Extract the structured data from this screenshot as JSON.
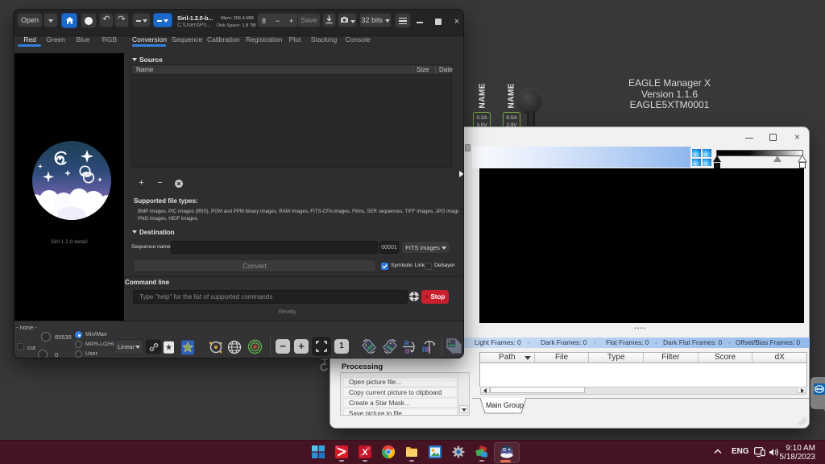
{
  "eagle": {
    "title": "EAGLE Manager X",
    "version": "Version 1.1.6",
    "serial": "EAGLE5XTM0001",
    "port_label_1": "NAME",
    "port_label_2": "NAME",
    "meter_1": {
      "current": "0.2A",
      "voltage": "3.0V"
    },
    "meter_2": {
      "current": "0.0A",
      "voltage": "2.9V"
    }
  },
  "siril": {
    "titlebar": {
      "open_label": "Open",
      "title": "Siril-1.2.0-b...",
      "subtitle": "C:\\Users\\Pri...",
      "mem": "Mem: 206.4 MiB",
      "disk": "Disk Space: 1.8 TiB",
      "zoom_value": "8",
      "minus": "−",
      "plus": "+",
      "save_label": "Save",
      "bit_depth": "32 bits"
    },
    "left_tabs": {
      "t0": "Red",
      "t1": "Green",
      "t2": "Blue",
      "t3": "RGB"
    },
    "logo_caption": "Siril 1.2.0-beta2",
    "right_tabs": {
      "t0": "Conversion",
      "t1": "Sequence",
      "t2": "Calibration",
      "t3": "Registration",
      "t4": "Plot",
      "t5": "Stacking",
      "t6": "Console"
    },
    "source": {
      "header": "Source",
      "col_name": "Name",
      "col_size": "Size",
      "col_date": "Date",
      "add": "+",
      "remove": "−"
    },
    "supported": {
      "label": "Supported file types:",
      "line1": "BMP images, PIC images (IRIS), PGM and PPM binary images, RAW images, FITS-CFA images, Films, SER sequences, TIFF images, JPG images,",
      "line2": "PNG images, HEIF images."
    },
    "destination": {
      "header": "Destination",
      "sequence_label": "Sequence name:",
      "sequence_value": "",
      "counter": "00001",
      "format": "FITS images",
      "convert_label": "Convert",
      "symbolic_link_label": "Symbolic Link",
      "debayer_label": "Debayer"
    },
    "command": {
      "header": "Command line",
      "placeholder": "Type \"help\" for the list of supported commands",
      "stop_label": "Stop",
      "status": "Ready."
    },
    "toolbar": {
      "none_label": "- none -",
      "cut_label": "cut",
      "hi_value": "65535",
      "lo_value": "0",
      "radio_minmax": "Min/Max",
      "radio_mips": "MIPS-LO/HI",
      "radio_user": "User",
      "scale_mode": "Linear",
      "minus": "−",
      "plus": "+",
      "zoom_one": "1"
    }
  },
  "astroart": {
    "frames_bar": {
      "f0_label": "Light Frames:",
      "f0_value": "0",
      "f1_label": "Dark Frames:",
      "f1_value": "0",
      "f2_label": "Flat Frames:",
      "f2_value": "0",
      "f3_label": "Dark Flat Frames:",
      "f3_value": "0",
      "f4_label": "Offset/Bias Frames:",
      "f4_value": "0",
      "sep": "-"
    },
    "table": {
      "col0": "Path",
      "col1": "File",
      "col2": "Type",
      "col3": "Filter",
      "col4": "Score",
      "col5": "dX"
    },
    "group_tab": "Main Group",
    "processing": {
      "title": "Processing",
      "item0": "Open picture file...",
      "item1": "Copy current picture to clipboard",
      "item2": "Create a Star Mask...",
      "item3": "Save picture to file..."
    }
  },
  "taskbar": {
    "language": "ENG",
    "time": "9:10 AM",
    "date": "5/18/2023"
  }
}
